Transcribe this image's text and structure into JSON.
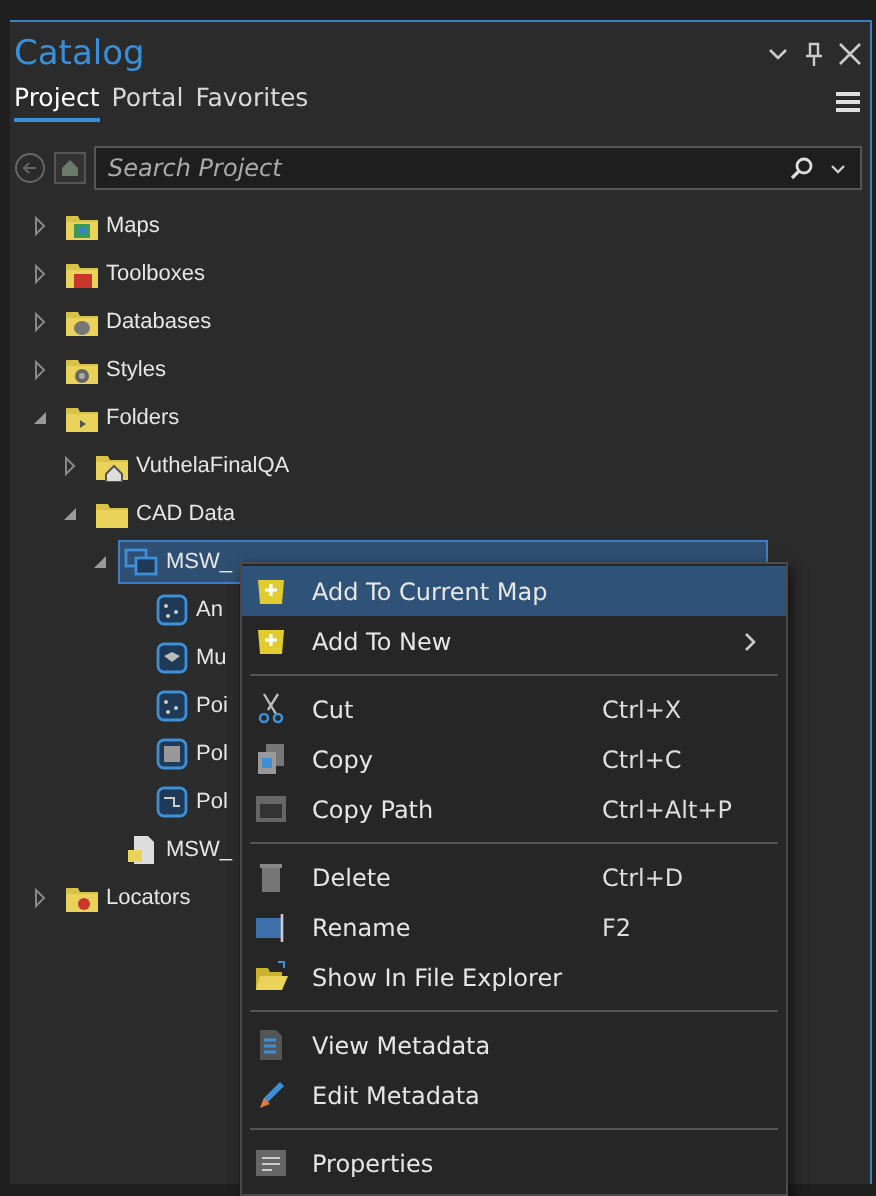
{
  "window": {
    "title": "Catalog"
  },
  "tabs": [
    {
      "label": "Project",
      "selected": true
    },
    {
      "label": "Portal",
      "selected": false
    },
    {
      "label": "Favorites",
      "selected": false
    }
  ],
  "search": {
    "placeholder": "Search Project"
  },
  "tree": [
    {
      "label": "Maps",
      "kind": "maps",
      "expanded": false
    },
    {
      "label": "Toolboxes",
      "kind": "toolbox",
      "expanded": false
    },
    {
      "label": "Databases",
      "kind": "database",
      "expanded": false
    },
    {
      "label": "Styles",
      "kind": "styles",
      "expanded": false
    },
    {
      "label": "Folders",
      "kind": "folders",
      "expanded": true,
      "children": [
        {
          "label": "VuthelaFinalQA",
          "kind": "homefolder",
          "expanded": false
        },
        {
          "label": "CAD Data",
          "kind": "folder",
          "expanded": true,
          "children": [
            {
              "label": "MSW_",
              "kind": "cad",
              "expanded": true,
              "selected": true,
              "children": [
                {
                  "label": "An",
                  "kind": "points",
                  "selected": false
                },
                {
                  "label": "Mu",
                  "kind": "multipatch",
                  "selected": false
                },
                {
                  "label": "Poi",
                  "kind": "points",
                  "selected": false
                },
                {
                  "label": "Pol",
                  "kind": "polygon",
                  "selected": false
                },
                {
                  "label": "Pol",
                  "kind": "polyline",
                  "selected": false
                }
              ]
            },
            {
              "label": "MSW_",
              "kind": "file",
              "selected": false
            }
          ]
        }
      ]
    },
    {
      "label": "Locators",
      "kind": "locators",
      "expanded": false
    }
  ],
  "context_menu": [
    {
      "kind": "item",
      "label": "Add To Current Map",
      "selected": true
    },
    {
      "kind": "item",
      "label": "Add To New",
      "selected": false,
      "submenu": true
    },
    {
      "kind": "separator"
    },
    {
      "kind": "item",
      "label": "Cut",
      "shortcut": "Ctrl+X",
      "selected": false
    },
    {
      "kind": "item",
      "label": "Copy",
      "shortcut": "Ctrl+C",
      "selected": false
    },
    {
      "kind": "item",
      "label": "Copy Path",
      "shortcut": "Ctrl+Alt+P",
      "selected": false
    },
    {
      "kind": "separator"
    },
    {
      "kind": "item",
      "label": "Delete",
      "shortcut": "Ctrl+D",
      "selected": false
    },
    {
      "kind": "item",
      "label": "Rename",
      "shortcut": "F2",
      "selected": false
    },
    {
      "kind": "item",
      "label": "Show In File Explorer",
      "selected": false
    },
    {
      "kind": "separator"
    },
    {
      "kind": "item",
      "label": "View Metadata",
      "selected": false
    },
    {
      "kind": "item",
      "label": "Edit Metadata",
      "selected": false
    },
    {
      "kind": "separator"
    },
    {
      "kind": "item",
      "label": "Properties",
      "selected": false
    }
  ]
}
